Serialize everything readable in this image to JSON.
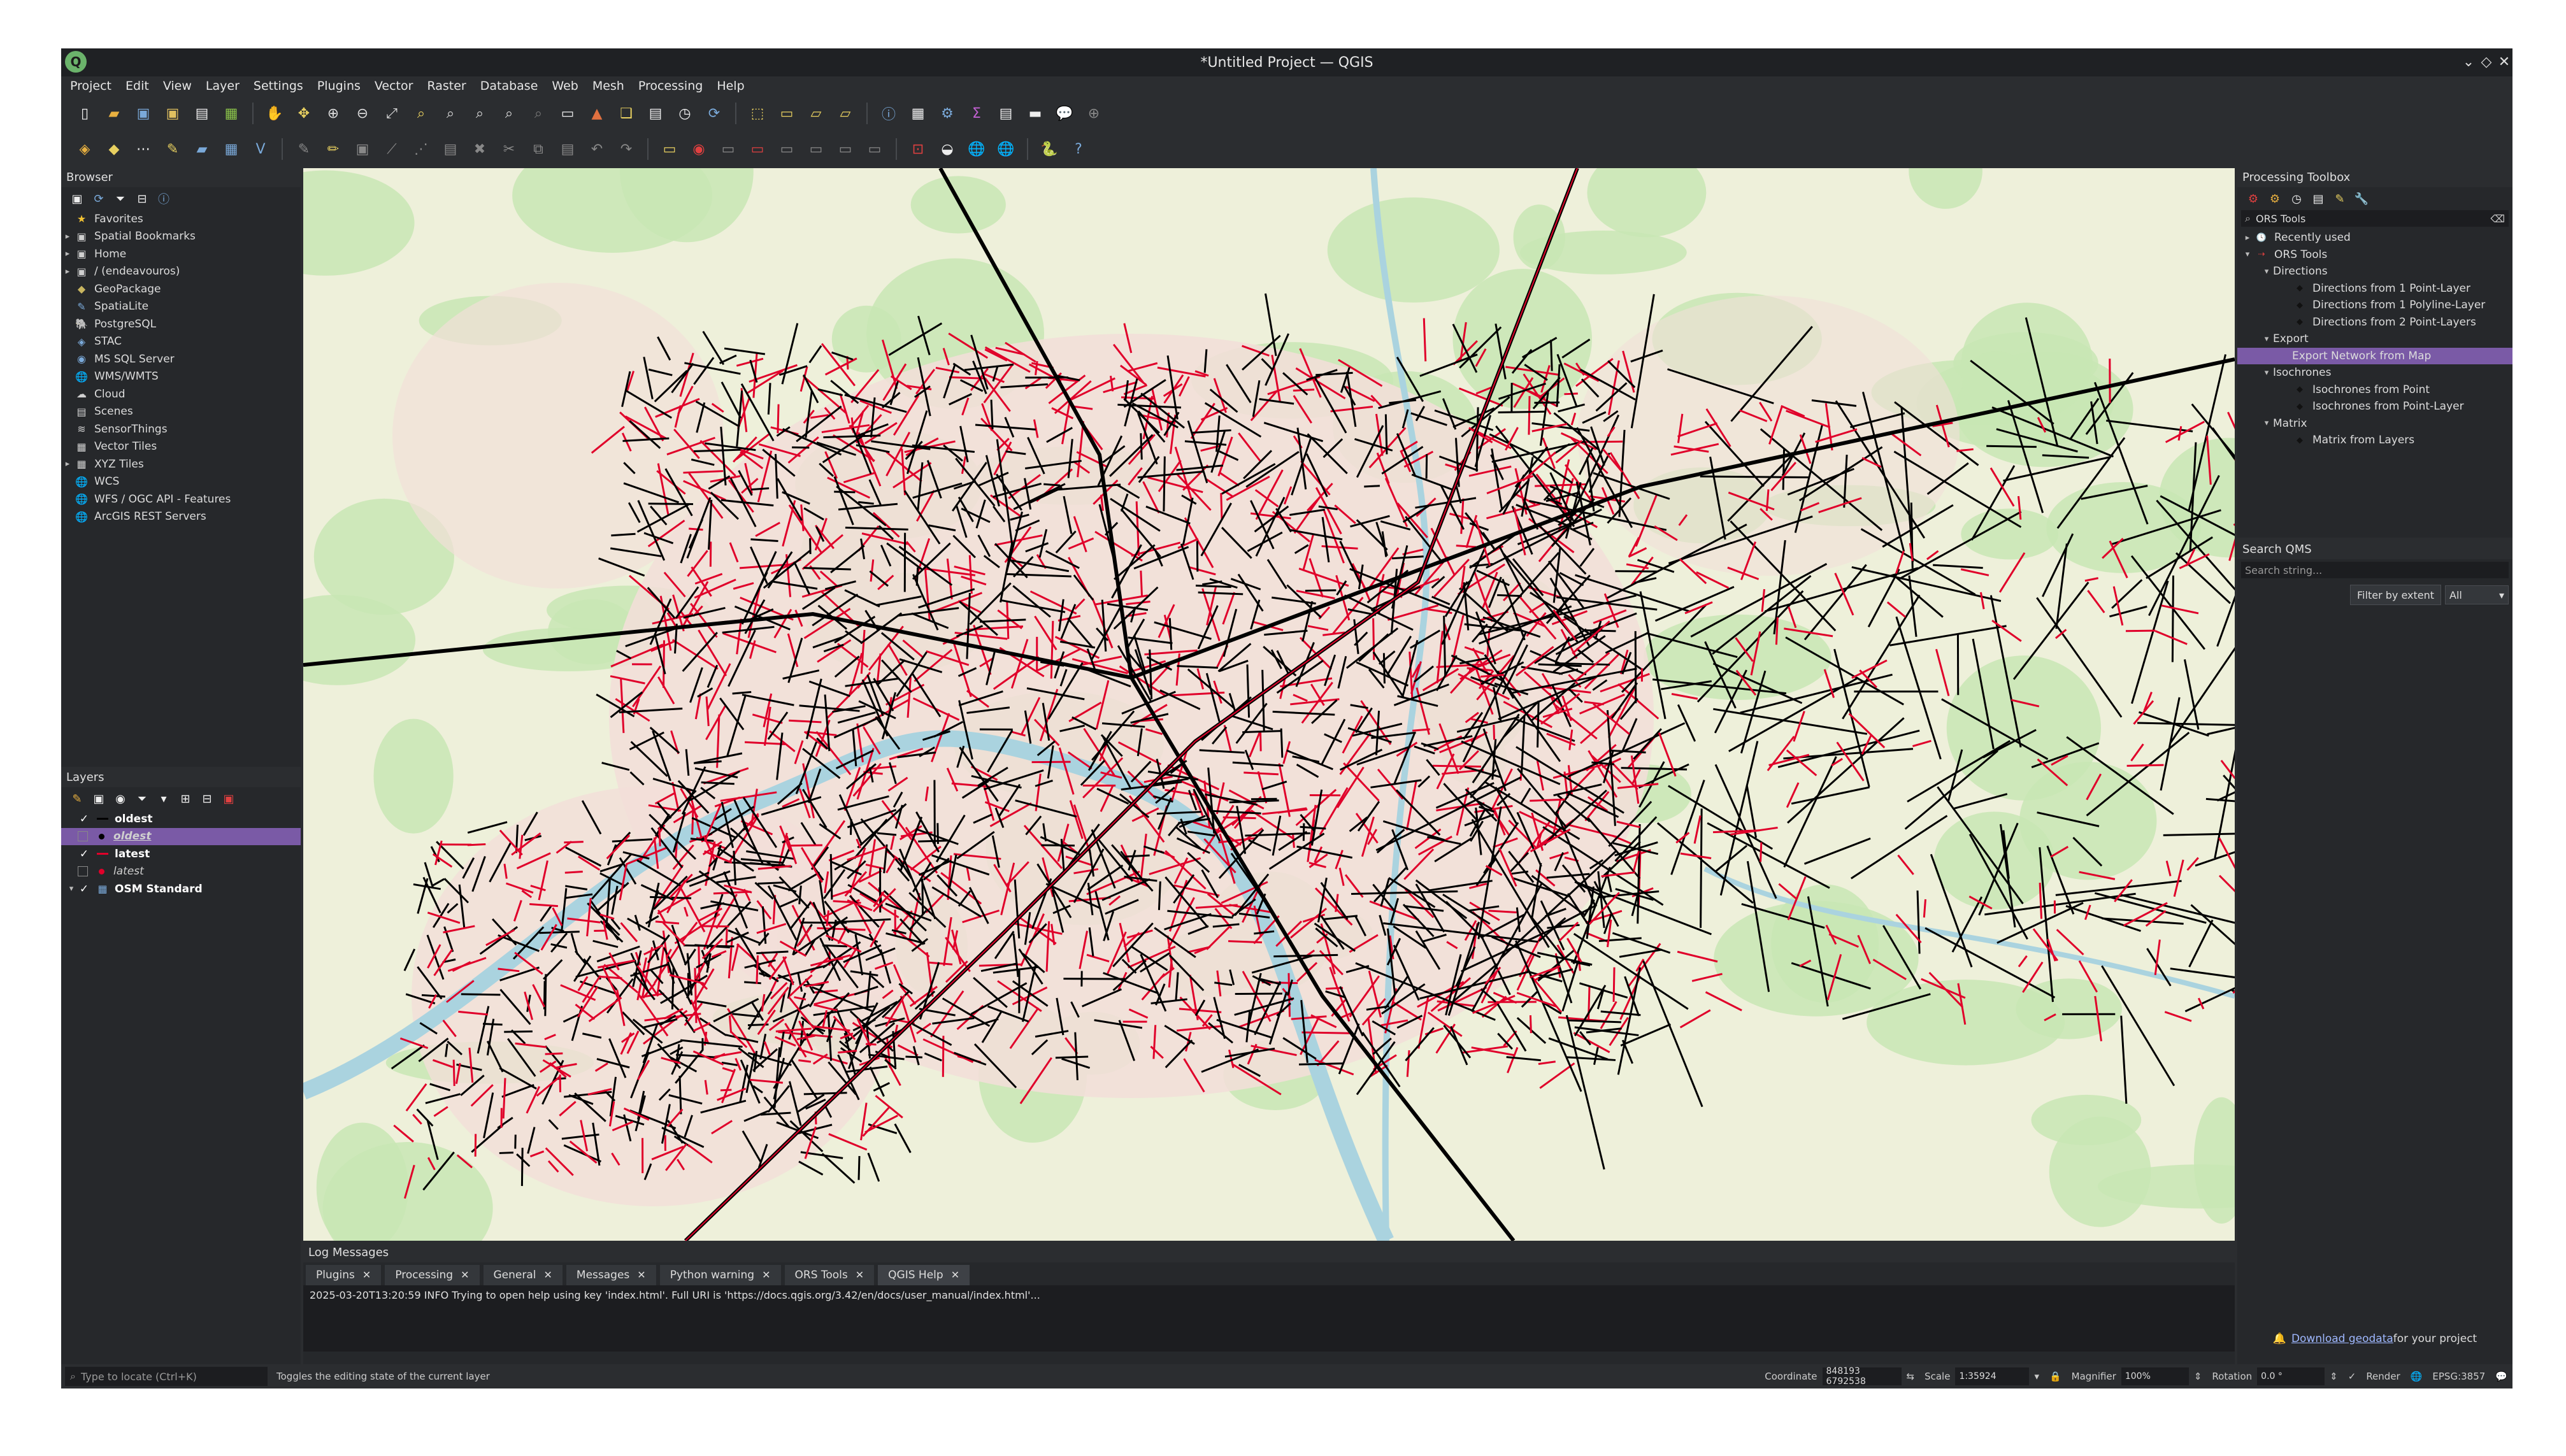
{
  "window": {
    "title": "*Untitled Project — QGIS",
    "logo_letter": "Q",
    "controls": [
      "⌄",
      "◇",
      "✕"
    ]
  },
  "menu": [
    "Project",
    "Edit",
    "View",
    "Layer",
    "Settings",
    "Plugins",
    "Vector",
    "Raster",
    "Database",
    "Web",
    "Mesh",
    "Processing",
    "Help"
  ],
  "browser": {
    "title": "Browser",
    "items": [
      {
        "label": "Favorites",
        "icon": "star-icon",
        "glyph": "★",
        "color": "#f2c233",
        "arrow": ""
      },
      {
        "label": "Spatial Bookmarks",
        "icon": "bookmark-icon",
        "glyph": "▣",
        "color": "#d0d0d0",
        "arrow": "▸"
      },
      {
        "label": "Home",
        "icon": "home-folder-icon",
        "glyph": "▣",
        "color": "#d0d0d0",
        "arrow": "▸"
      },
      {
        "label": "/ (endeavouros)",
        "icon": "drive-icon",
        "glyph": "▣",
        "color": "#d0d0d0",
        "arrow": "▸"
      },
      {
        "label": "GeoPackage",
        "icon": "geopackage-icon",
        "glyph": "◆",
        "color": "#c8b560",
        "arrow": ""
      },
      {
        "label": "SpatiaLite",
        "icon": "spatialite-icon",
        "glyph": "✎",
        "color": "#7aa9d9",
        "arrow": ""
      },
      {
        "label": "PostgreSQL",
        "icon": "postgresql-icon",
        "glyph": "🐘",
        "color": "#7aa9d9",
        "arrow": ""
      },
      {
        "label": "STAC",
        "icon": "stac-icon",
        "glyph": "◈",
        "color": "#7aa9d9",
        "arrow": ""
      },
      {
        "label": "MS SQL Server",
        "icon": "mssql-icon",
        "glyph": "◉",
        "color": "#7aa9d9",
        "arrow": ""
      },
      {
        "label": "WMS/WMTS",
        "icon": "wms-icon",
        "glyph": "🌐",
        "color": "#7aa9d9",
        "arrow": ""
      },
      {
        "label": "Cloud",
        "icon": "cloud-icon",
        "glyph": "☁",
        "color": "#d0d0d0",
        "arrow": ""
      },
      {
        "label": "Scenes",
        "icon": "scenes-icon",
        "glyph": "▤",
        "color": "#d0d0d0",
        "arrow": ""
      },
      {
        "label": "SensorThings",
        "icon": "sensorthings-icon",
        "glyph": "≋",
        "color": "#d0d0d0",
        "arrow": ""
      },
      {
        "label": "Vector Tiles",
        "icon": "vector-tiles-icon",
        "glyph": "▦",
        "color": "#d0d0d0",
        "arrow": ""
      },
      {
        "label": "XYZ Tiles",
        "icon": "xyz-tiles-icon",
        "glyph": "▦",
        "color": "#d0d0d0",
        "arrow": "▸"
      },
      {
        "label": "WCS",
        "icon": "wcs-icon",
        "glyph": "🌐",
        "color": "#7aa9d9",
        "arrow": ""
      },
      {
        "label": "WFS / OGC API - Features",
        "icon": "wfs-icon",
        "glyph": "🌐",
        "color": "#7aa9d9",
        "arrow": ""
      },
      {
        "label": "ArcGIS REST Servers",
        "icon": "arcgis-icon",
        "glyph": "🌐",
        "color": "#7aa9d9",
        "arrow": ""
      }
    ]
  },
  "layers": {
    "title": "Layers",
    "items": [
      {
        "label": "oldest",
        "style": "bold",
        "checked": true,
        "indent": 0,
        "symbol": "line",
        "color": "#000000",
        "arrow": "",
        "selected": false
      },
      {
        "label": "oldest",
        "style": "bold-ital",
        "checked": false,
        "indent": 0,
        "symbol": "point",
        "color": "#000000",
        "arrow": "",
        "selected": true
      },
      {
        "label": "latest",
        "style": "bold",
        "checked": true,
        "indent": 0,
        "symbol": "line",
        "color": "#e0002a",
        "arrow": "",
        "selected": false
      },
      {
        "label": "latest",
        "style": "ital",
        "checked": false,
        "indent": 0,
        "symbol": "point",
        "color": "#e0002a",
        "arrow": "",
        "selected": false
      },
      {
        "label": "OSM Standard",
        "style": "bold",
        "checked": true,
        "indent": 0,
        "symbol": "raster",
        "color": "#7aa9d9",
        "arrow": "▾",
        "selected": false
      }
    ]
  },
  "toolbox": {
    "title": "Processing Toolbox",
    "search_value": "ORS Tools",
    "tree": [
      {
        "label": "Recently used",
        "indent": 0,
        "arrow": "▸",
        "icon": "clock-icon",
        "glyph": "🕓",
        "selected": false
      },
      {
        "label": "ORS Tools",
        "indent": 0,
        "arrow": "▾",
        "icon": "ors-icon",
        "glyph": "⇢",
        "selected": false
      },
      {
        "label": "Directions",
        "indent": 1,
        "arrow": "▾",
        "icon": "",
        "glyph": "",
        "selected": false
      },
      {
        "label": "Directions from 1 Point-Layer",
        "indent": 2,
        "arrow": "",
        "icon": "tool-icon",
        "glyph": "◆",
        "selected": false
      },
      {
        "label": "Directions from 1 Polyline-Layer",
        "indent": 2,
        "arrow": "",
        "icon": "tool-icon",
        "glyph": "◆",
        "selected": false
      },
      {
        "label": "Directions from 2 Point-Layers",
        "indent": 2,
        "arrow": "",
        "icon": "tool-icon",
        "glyph": "◆",
        "selected": false
      },
      {
        "label": "Export",
        "indent": 1,
        "arrow": "▾",
        "icon": "",
        "glyph": "",
        "selected": false
      },
      {
        "label": "Export Network from Map",
        "indent": 2,
        "arrow": "",
        "icon": "",
        "glyph": "",
        "selected": true
      },
      {
        "label": "Isochrones",
        "indent": 1,
        "arrow": "▾",
        "icon": "",
        "glyph": "",
        "selected": false
      },
      {
        "label": "Isochrones from Point",
        "indent": 2,
        "arrow": "",
        "icon": "tool-icon",
        "glyph": "◆",
        "selected": false
      },
      {
        "label": "Isochrones from Point-Layer",
        "indent": 2,
        "arrow": "",
        "icon": "tool-icon",
        "glyph": "◆",
        "selected": false
      },
      {
        "label": "Matrix",
        "indent": 1,
        "arrow": "▾",
        "icon": "",
        "glyph": "",
        "selected": false
      },
      {
        "label": "Matrix from Layers",
        "indent": 2,
        "arrow": "",
        "icon": "tool-icon",
        "glyph": "◆",
        "selected": false
      }
    ]
  },
  "qms": {
    "title": "Search QMS",
    "search_placeholder": "Search string...",
    "filter_label": "Filter by extent",
    "select_value": "All"
  },
  "log": {
    "title": "Log Messages",
    "tabs": [
      "Plugins",
      "Processing",
      "General",
      "Messages",
      "Python warning",
      "ORS Tools",
      "QGIS Help"
    ],
    "active_tab": "QGIS Help",
    "line": "2025-03-20T13:20:59     INFO     Trying to open help using key 'index.html'. Full URI is 'https://docs.qgis.org/3.42/en/docs/user_manual/index.html'..."
  },
  "download": {
    "link": "Download geodata",
    "suffix": " for your project"
  },
  "status": {
    "locator_placeholder": "Type to locate (Ctrl+K)",
    "message": "Toggles the editing state of the current layer",
    "coordinate_label": "Coordinate",
    "coordinate_value": "848193  6792538",
    "scale_label": "Scale",
    "scale_value": "1:35924",
    "magnifier_label": "Magnifier",
    "magnifier_value": "100%",
    "rotation_label": "Rotation",
    "rotation_value": "0.0 °",
    "render_label": "Render",
    "crs": "EPSG:3857"
  },
  "colors": {
    "accent": "#7a5aa6",
    "network_red": "#e0002a",
    "network_black": "#000000",
    "water": "#aad3df",
    "park": "#c8e6b4",
    "urban": "#f2dfd8",
    "land": "#eef0da"
  }
}
